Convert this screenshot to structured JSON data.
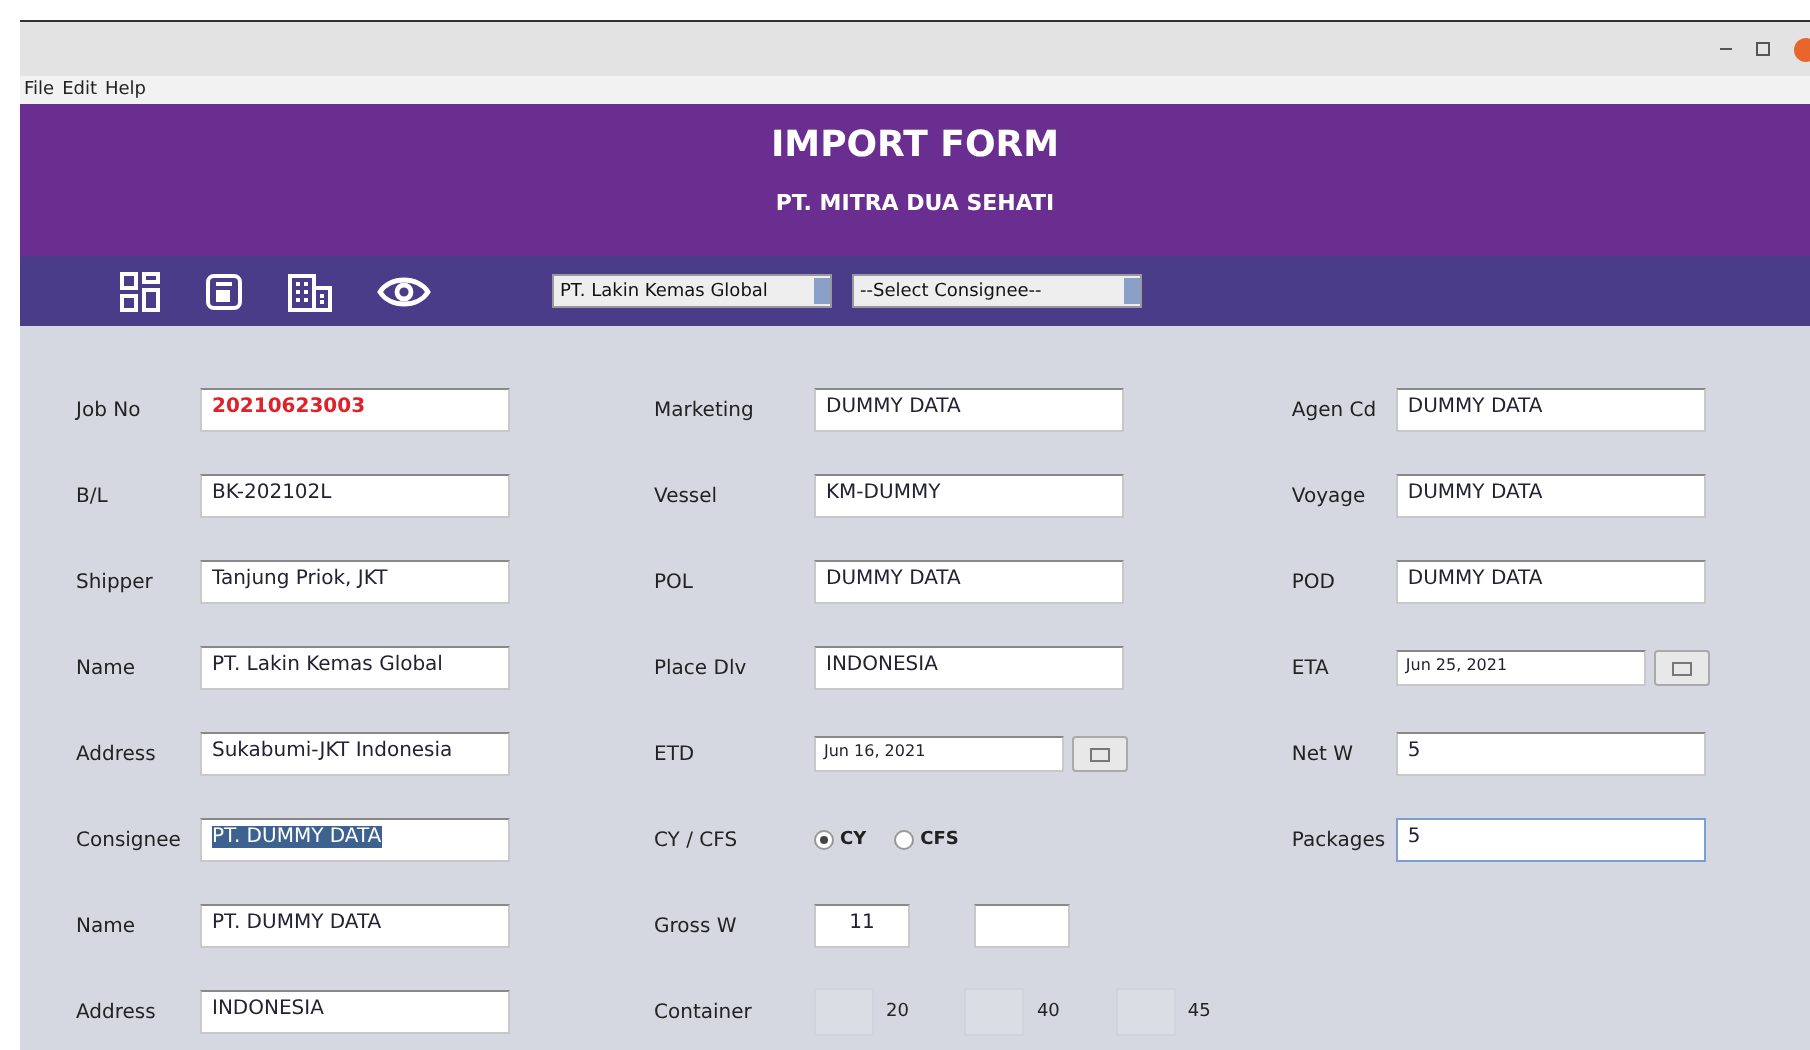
{
  "menu": [
    "File",
    "Edit",
    "Help"
  ],
  "header": {
    "title": "IMPORT FORM",
    "subtitle": "PT. MITRA DUA SEHATI"
  },
  "toolbar": {
    "dropdowns": [
      {
        "value": "PT. Lakin Kemas Global"
      },
      {
        "value": "--Select Consignee--"
      }
    ]
  },
  "columns": [
    {
      "fields": [
        {
          "kind": "text",
          "label": "Job No",
          "value": "20210623003",
          "alert": true
        },
        {
          "kind": "text",
          "label": "B/L",
          "value": "BK-202102L"
        },
        {
          "kind": "text",
          "label": "Shipper",
          "value": "Tanjung Priok, JKT"
        },
        {
          "kind": "text",
          "label": "Name",
          "value": "PT. Lakin Kemas Global"
        },
        {
          "kind": "text",
          "label": "Address",
          "value": "Sukabumi-JKT Indonesia"
        },
        {
          "kind": "text",
          "label": "Consignee",
          "value": "PT. DUMMY DATA",
          "text_selected": true
        },
        {
          "kind": "text",
          "label": "Name",
          "value": "PT. DUMMY DATA"
        },
        {
          "kind": "text",
          "label": "Address",
          "value": "INDONESIA"
        }
      ]
    },
    {
      "fields": [
        {
          "kind": "text",
          "label": "Marketing",
          "value": "DUMMY DATA"
        },
        {
          "kind": "text",
          "label": "Vessel",
          "value": "KM-DUMMY"
        },
        {
          "kind": "text",
          "label": "POL",
          "value": "DUMMY DATA"
        },
        {
          "kind": "text",
          "label": "Place Dlv",
          "value": "INDONESIA"
        },
        {
          "kind": "date",
          "label": "ETD",
          "value": "Jun 16, 2021"
        },
        {
          "kind": "radio",
          "label": "CY / CFS",
          "options": [
            {
              "label": "CY",
              "selected": true
            },
            {
              "label": "CFS",
              "selected": false
            }
          ]
        },
        {
          "kind": "pair",
          "label": "Gross W",
          "value": "11"
        },
        {
          "kind": "checks",
          "label": "Container",
          "options": [
            {
              "label": "20",
              "checked": false
            },
            {
              "label": "40",
              "checked": false
            },
            {
              "label": "45",
              "checked": false
            }
          ]
        }
      ]
    },
    {
      "fields": [
        {
          "kind": "text",
          "label": "Agen Cd",
          "value": "DUMMY DATA"
        },
        {
          "kind": "text",
          "label": "Voyage",
          "value": "DUMMY DATA"
        },
        {
          "kind": "text",
          "label": "POD",
          "value": "DUMMY DATA"
        },
        {
          "kind": "date",
          "label": "ETA",
          "value": "Jun 25, 2021"
        },
        {
          "kind": "text",
          "label": "Net W",
          "value": "5"
        },
        {
          "kind": "text",
          "label": "Packages",
          "value": "5",
          "focused": true
        }
      ]
    }
  ]
}
